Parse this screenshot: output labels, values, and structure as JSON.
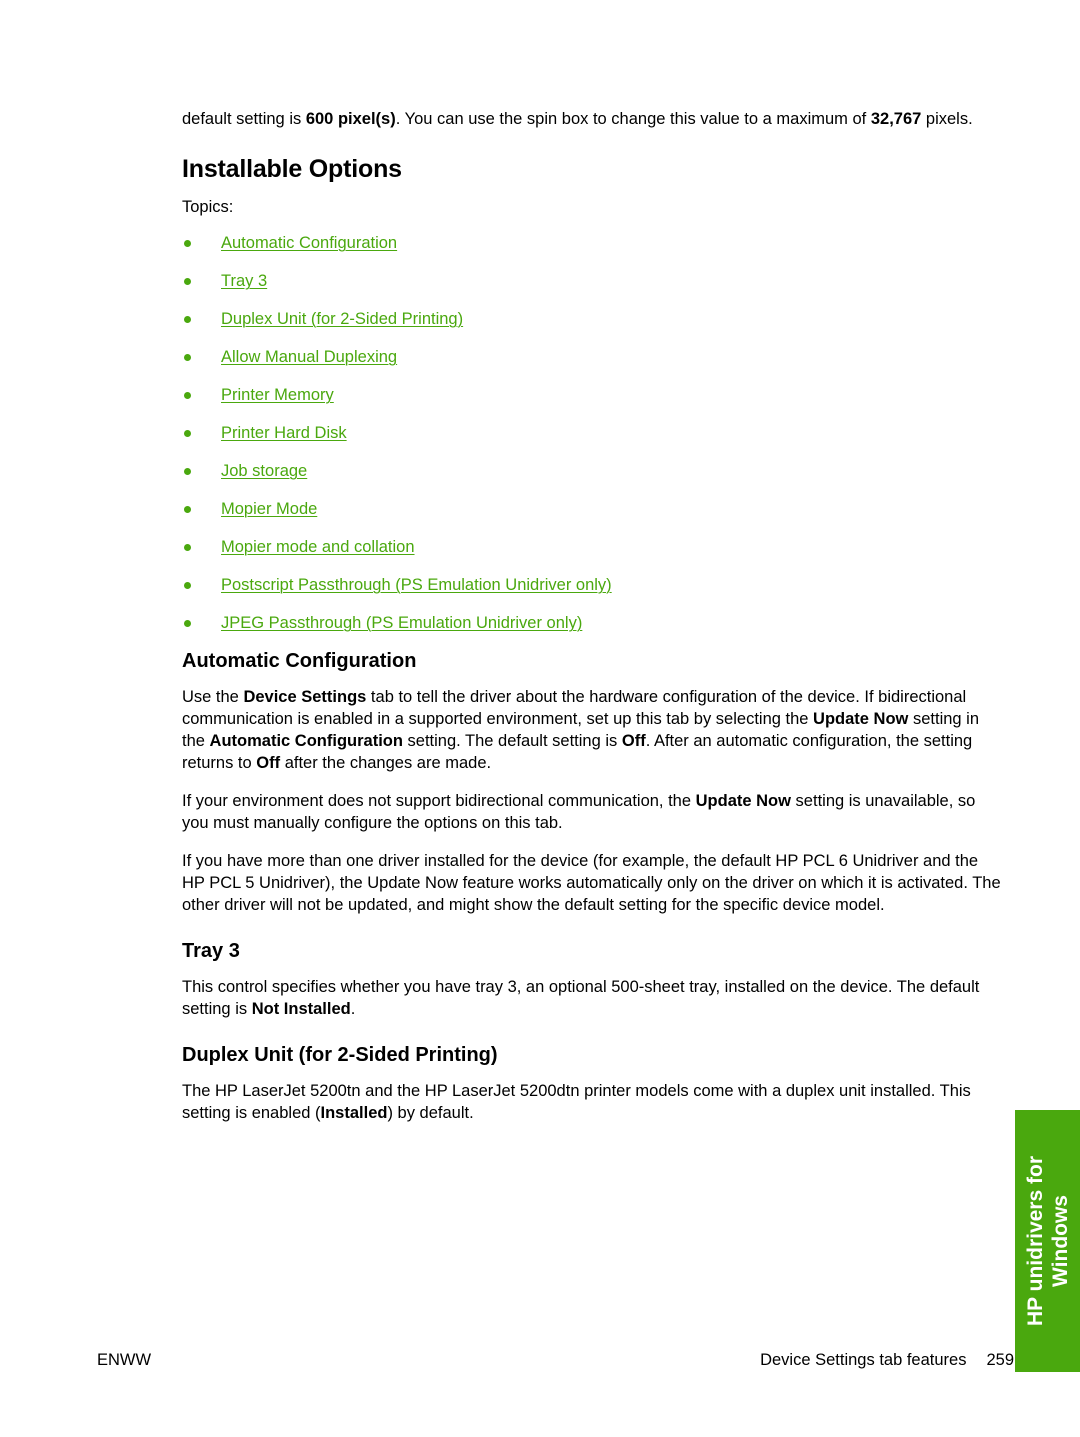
{
  "intro": {
    "t1": "default setting is ",
    "b1": "600 pixel(s)",
    "t2": ". You can use the spin box to change this value to a maximum of ",
    "b2": "32,767",
    "t3": " pixels."
  },
  "section_title": "Installable Options",
  "topics_label": "Topics:",
  "topics": [
    {
      "label": "Automatic Configuration"
    },
    {
      "label": "Tray 3"
    },
    {
      "label": "Duplex Unit (for 2-Sided Printing)"
    },
    {
      "label": "Allow Manual Duplexing"
    },
    {
      "label": "Printer Memory"
    },
    {
      "label": "Printer Hard Disk"
    },
    {
      "label": "Job storage"
    },
    {
      "label": "Mopier Mode"
    },
    {
      "label": "Mopier mode and collation"
    },
    {
      "label": "Postscript Passthrough (PS Emulation Unidriver only)"
    },
    {
      "label": "JPEG Passthrough (PS Emulation Unidriver only)"
    }
  ],
  "auto_config": {
    "heading": "Automatic Configuration",
    "p1": {
      "t1": "Use the ",
      "b1": "Device Settings",
      "t2": " tab to tell the driver about the hardware configuration of the device. If bidirectional communication is enabled in a supported environment, set up this tab by selecting the ",
      "b2": "Update Now",
      "t3": " setting in the ",
      "b3": "Automatic Configuration",
      "t4": " setting. The default setting is ",
      "b4": "Off",
      "t5": ". After an automatic configuration, the setting returns to ",
      "b5": "Off",
      "t6": " after the changes are made."
    },
    "p2": {
      "t1": "If your environment does not support bidirectional communication, the ",
      "b1": "Update Now",
      "t2": " setting is unavailable, so you must manually configure the options on this tab."
    },
    "p3": "If you have more than one driver installed for the device (for example, the default HP PCL 6 Unidriver and the HP PCL 5 Unidriver), the Update Now feature works automatically only on the driver on which it is activated. The other driver will not be updated, and might show the default setting for the specific device model."
  },
  "tray3": {
    "heading": "Tray 3",
    "p1": {
      "t1": "This control specifies whether you have tray 3, an optional 500-sheet tray, installed on the device. The default setting is ",
      "b1": "Not Installed",
      "t2": "."
    }
  },
  "duplex": {
    "heading": "Duplex Unit (for 2-Sided Printing)",
    "p1": {
      "t1": "The HP LaserJet 5200tn and the HP LaserJet 5200dtn printer models come with a duplex unit installed. This setting is enabled (",
      "b1": "Installed",
      "t2": ") by default."
    }
  },
  "footer": {
    "left": "ENWW",
    "section": "Device Settings tab features",
    "page": "259"
  },
  "side_tab": {
    "line1": "HP unidrivers for",
    "line2": "Windows",
    "color": "#4aa80e"
  },
  "colors": {
    "link": "#4aa80e"
  }
}
